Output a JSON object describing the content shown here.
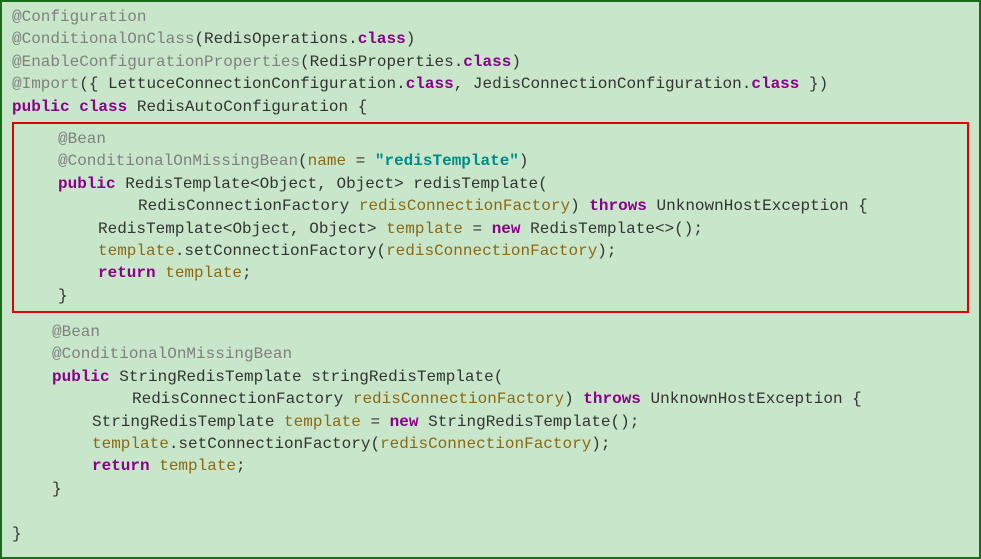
{
  "annotations": {
    "configuration": "@Configuration",
    "conditionalOnClass": "@ConditionalOnClass",
    "enableConfigProps": "@EnableConfigurationProperties",
    "import": "@Import",
    "bean": "@Bean",
    "conditionalOnMissingBean": "@ConditionalOnMissingBean"
  },
  "keywords": {
    "class_kw": "class",
    "public": "public",
    "new": "new",
    "throws": "throws",
    "return": "return"
  },
  "types": {
    "redisOperations": "RedisOperations",
    "redisProperties": "RedisProperties",
    "lettuceConfig": "LettuceConnectionConfiguration",
    "jedisConfig": "JedisConnectionConfiguration",
    "redisAutoConfig": "RedisAutoConfiguration",
    "redisTemplate": "RedisTemplate",
    "object": "Object",
    "redisConnFactory": "RedisConnectionFactory",
    "unknownHostEx": "UnknownHostException",
    "stringRedisTemplate": "StringRedisTemplate"
  },
  "params": {
    "name": "name",
    "redisConnFactory": "redisConnectionFactory",
    "template": "template"
  },
  "strings": {
    "redisTemplate": "\"redisTemplate\""
  },
  "methods": {
    "redisTemplate": "redisTemplate",
    "stringRedisTemplate": "stringRedisTemplate",
    "setConnectionFactory": "setConnectionFactory"
  },
  "symbols": {
    "openParen": "(",
    "closeParen": ")",
    "openBrace": "{",
    "closeBrace": "}",
    "openAngle": "<",
    "closeAngle": ">",
    "dot": ".",
    "comma": ", ",
    "semicolon": ";",
    "equals": " = ",
    "diamond": "<>",
    "parens": "()",
    "openBracket": "({ ",
    "closeBracket": " })"
  }
}
